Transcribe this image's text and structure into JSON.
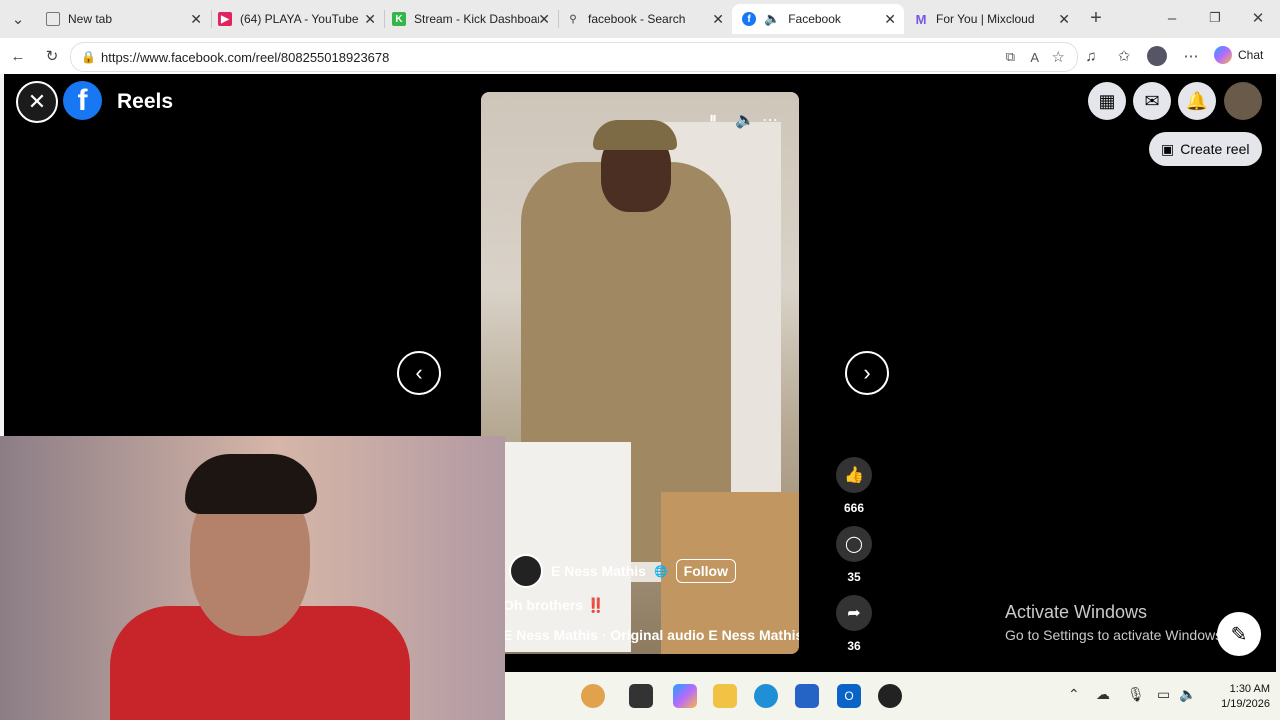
{
  "browser": {
    "tabs": [
      {
        "label": "New tab",
        "icon": "newtab-icon"
      },
      {
        "label": "(64) PLAYA - YouTube",
        "icon": "youtube-icon"
      },
      {
        "label": "Stream - Kick Dashboard",
        "icon": "kick-icon"
      },
      {
        "label": "facebook - Search",
        "icon": "search-icon"
      },
      {
        "label": "Facebook",
        "icon": "facebook-icon",
        "active": true
      },
      {
        "label": "For You | Mixcloud",
        "icon": "mixcloud-icon"
      }
    ],
    "url": "https://www.facebook.com/reel/808255018923678",
    "chat_label": "Chat"
  },
  "page": {
    "title": "Reels",
    "create_reel_label": "Create reel",
    "reel": {
      "author": "E Ness Mathis",
      "follow_label": "Follow",
      "caption": "Oh brothers ‼️",
      "audio": "E Ness Mathis · Original audio     E Ness Mathis · O",
      "likes": "666",
      "comments": "35",
      "shares": "36"
    },
    "watermark": {
      "line1": "Activate Windows",
      "line2": "Go to Settings to activate Windows."
    }
  },
  "taskbar": {
    "time": "1:30 AM",
    "date": "1/19/2026"
  },
  "colors": {
    "facebook_blue": "#1877f2",
    "page_background": "#000000",
    "button_gray": "#e4e6eb"
  }
}
